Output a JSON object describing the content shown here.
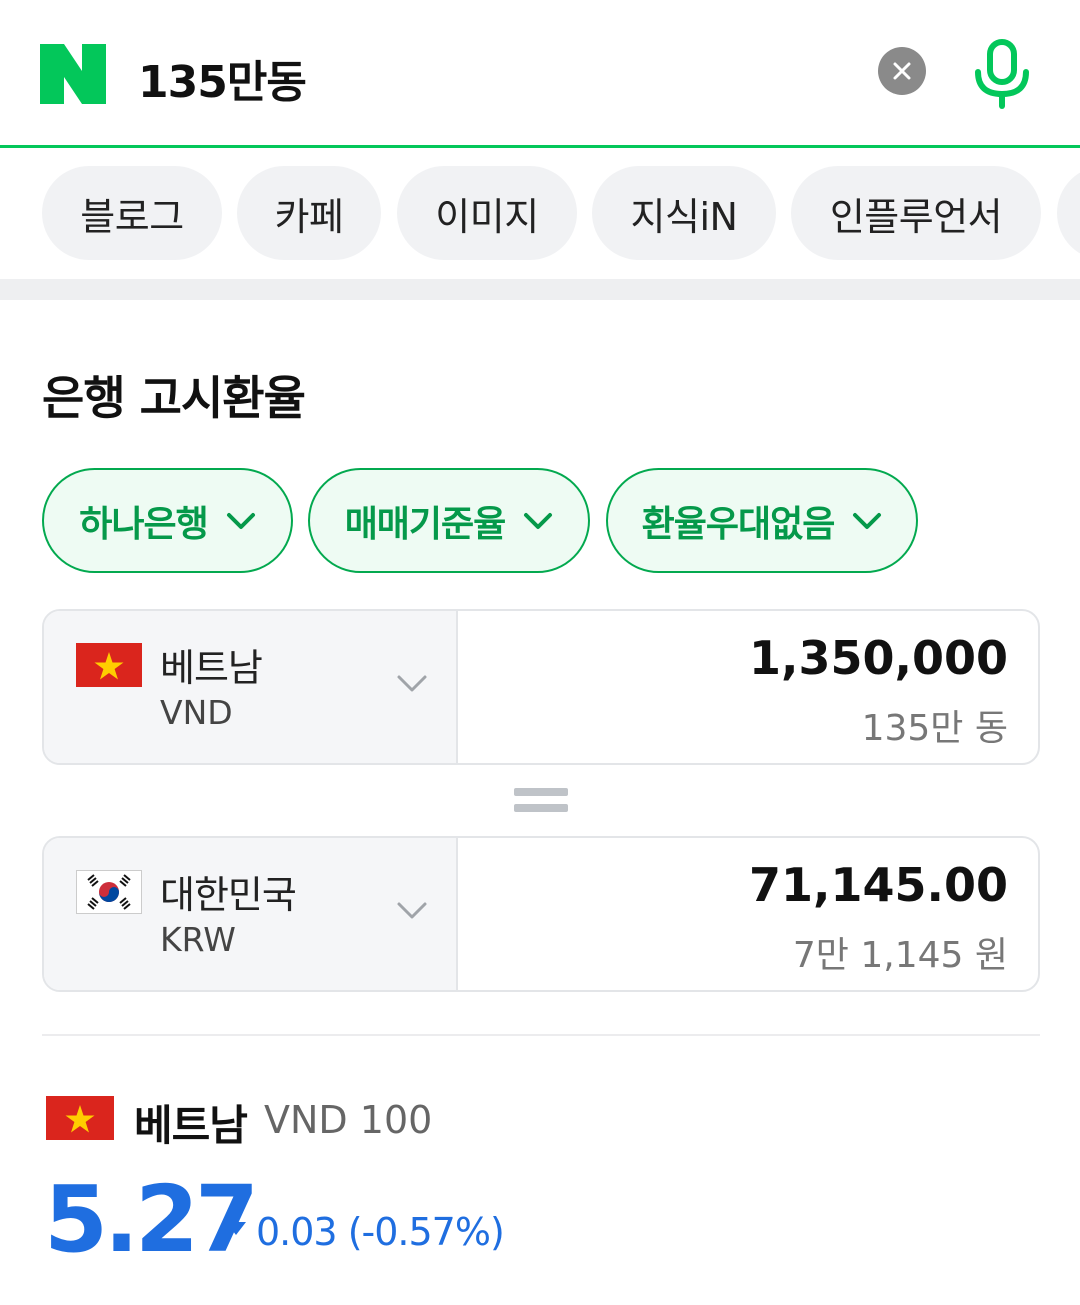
{
  "search": {
    "query": "135만동"
  },
  "tabs": [
    "블로그",
    "카페",
    "이미지",
    "지식iN",
    "인플루언서"
  ],
  "section": {
    "title": "은행 고시환율"
  },
  "filters": [
    {
      "label": "하나은행"
    },
    {
      "label": "매매기준율"
    },
    {
      "label": "환율우대없음"
    }
  ],
  "converter": {
    "from": {
      "country": "베트남",
      "code": "VND",
      "amount": "1,350,000",
      "amount_words": "135만 동",
      "flag_icon": "vietnam-flag-icon"
    },
    "to": {
      "country": "대한민국",
      "code": "KRW",
      "amount": "71,145.00",
      "amount_words": "7만 1,145 원",
      "flag_icon": "korea-flag-icon"
    }
  },
  "rate": {
    "country": "베트남",
    "unit": "VND 100",
    "value": "5.27",
    "change": "0.03 (-0.57%)",
    "direction_icon": "down-triangle-icon"
  },
  "colors": {
    "brand_green": "#03c75a",
    "chip_green": "#05994a",
    "rate_blue": "#1f6ee0"
  }
}
